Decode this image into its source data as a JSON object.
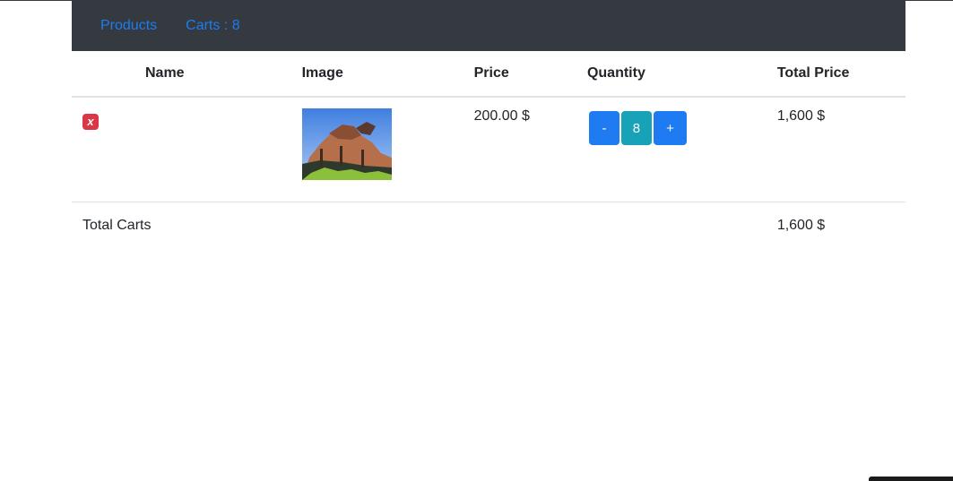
{
  "nav": {
    "products_label": "Products",
    "carts_label": "Carts : 8"
  },
  "table": {
    "headers": {
      "name": "Name",
      "image": "Image",
      "price": "Price",
      "quantity": "Quantity",
      "total": "Total Price"
    },
    "items": [
      {
        "remove_label": "x",
        "image_icon": "building-photo",
        "price": "200.00 $",
        "decrement_label": "-",
        "quantity": "8",
        "increment_label": "+",
        "total": "1,600 $"
      }
    ],
    "footer": {
      "label": "Total Carts",
      "total": "1,600 $"
    }
  },
  "colors": {
    "navbar": "#343a40",
    "link": "#1e7bf2",
    "primary": "#1e7bf2",
    "info": "#17a2b8",
    "danger": "#dc3545"
  }
}
